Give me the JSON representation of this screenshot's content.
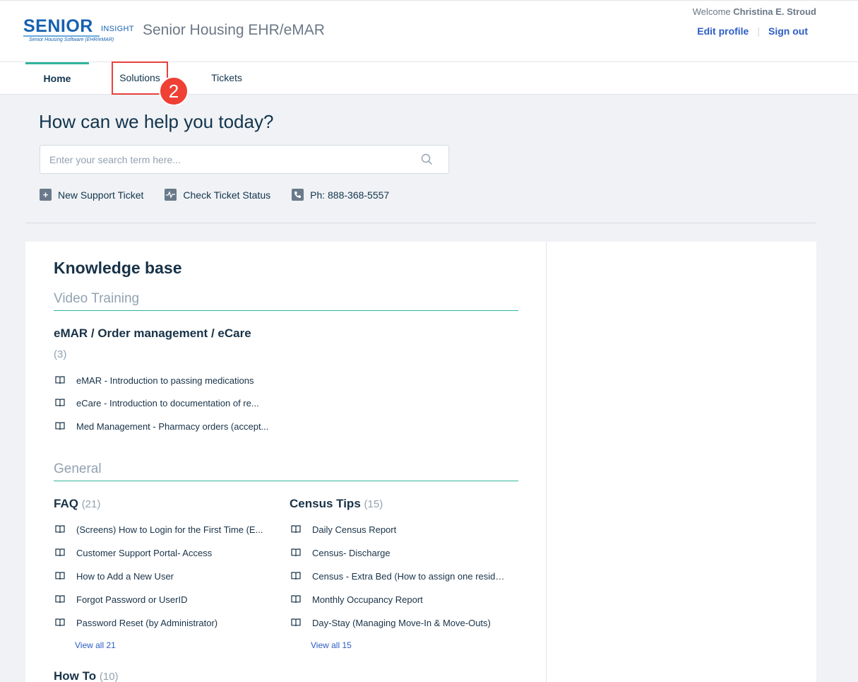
{
  "header": {
    "logo_text": "SENIOR",
    "logo_insight": "INSIGHT",
    "logo_subtitle": "Senior Housing Software (EHR/eMAR)",
    "portal_title": "Senior Housing EHR/eMAR",
    "welcome_prefix": "Welcome",
    "user_name": "Christina E. Stroud",
    "edit_profile": "Edit profile",
    "sign_out": "Sign out"
  },
  "nav": {
    "tabs": [
      {
        "label": "Home",
        "active": true
      },
      {
        "label": "Solutions",
        "active": false
      },
      {
        "label": "Tickets",
        "active": false
      }
    ],
    "annotation_badge": "2"
  },
  "hero": {
    "title": "How can we help you today?",
    "search_placeholder": "Enter your search term here...",
    "quick_links": [
      {
        "label": "New Support Ticket",
        "icon": "plus-icon"
      },
      {
        "label": "Check Ticket Status",
        "icon": "pulse-icon"
      },
      {
        "label": "Ph: 888-368-5557",
        "icon": "phone-icon"
      }
    ]
  },
  "knowledge_base": {
    "title": "Knowledge base",
    "sections": [
      {
        "name": "Video Training",
        "categories": [
          {
            "title": "eMAR / Order management / eCare",
            "count": "(3)",
            "articles": [
              "eMAR - Introduction to passing medications",
              "eCare - Introduction to documentation of re...",
              "Med Management - Pharmacy orders (accept..."
            ]
          }
        ]
      },
      {
        "name": "General",
        "categories": [
          {
            "title": "FAQ",
            "count": "(21)",
            "articles": [
              "(Screens) How to Login for the First Time (E...",
              "Customer Support Portal- Access",
              "How to Add a New User",
              "Forgot Password or UserID",
              "Password Reset (by Administrator)"
            ],
            "view_all": "View all 21"
          },
          {
            "title": "Census Tips",
            "count": "(15)",
            "articles": [
              "Daily Census Report",
              "Census- Discharge",
              "Census - Extra Bed (How to assign one reside...",
              "Monthly Occupancy Report",
              "Day-Stay (Managing Move-In & Move-Outs)"
            ],
            "view_all": "View all 15"
          },
          {
            "title": "How To",
            "count": "(10)"
          }
        ]
      }
    ]
  },
  "colors": {
    "accent": "#2fb59c",
    "link": "#2c5cc5",
    "badge": "#ef4036",
    "text": "#183247"
  }
}
